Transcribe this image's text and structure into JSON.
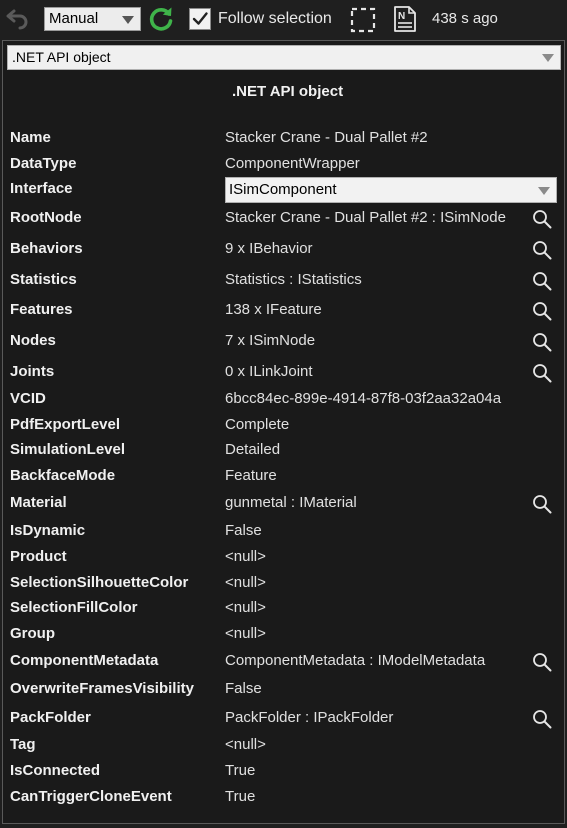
{
  "toolbar": {
    "undo_icon": "undo-icon",
    "mode_value": "Manual",
    "refresh_icon": "refresh-icon",
    "follow_checked": true,
    "follow_label": "Follow selection",
    "select_icon": "selection-frame-icon",
    "doc_icon": "document-icon",
    "doc_icon_glyph": "N",
    "timer_label": "438 s ago",
    "accent_green": "#3fb44a"
  },
  "object_selector": {
    "value": ".NET API object"
  },
  "header": {
    "title": ".NET API object"
  },
  "properties": [
    {
      "name": "Name",
      "value": "Stacker Crane - Dual Pallet #2",
      "search": false
    },
    {
      "name": "DataType",
      "value": "ComponentWrapper",
      "search": false
    },
    {
      "name": "Interface",
      "value": "ISimComponent",
      "search": false,
      "is_dropdown": true
    },
    {
      "name": "RootNode",
      "value": "Stacker Crane - Dual Pallet #2 : ISimNode",
      "search": true
    },
    {
      "name": "Behaviors",
      "value": "9 x IBehavior",
      "search": true
    },
    {
      "name": "Statistics",
      "value": "Statistics : IStatistics",
      "search": true
    },
    {
      "name": "Features",
      "value": "138 x IFeature",
      "search": true
    },
    {
      "name": "Nodes",
      "value": "7 x ISimNode",
      "search": true
    },
    {
      "name": "Joints",
      "value": "0 x ILinkJoint",
      "search": true
    },
    {
      "name": "VCID",
      "value": "6bcc84ec-899e-4914-87f8-03f2aa32a04a",
      "search": false
    },
    {
      "name": "PdfExportLevel",
      "value": "Complete",
      "search": false
    },
    {
      "name": "SimulationLevel",
      "value": "Detailed",
      "search": false
    },
    {
      "name": "BackfaceMode",
      "value": "Feature",
      "search": false
    },
    {
      "name": "Material",
      "value": "gunmetal : IMaterial",
      "search": true
    },
    {
      "name": "IsDynamic",
      "value": "False",
      "search": false
    },
    {
      "name": "Product",
      "value": "<null>",
      "search": false
    },
    {
      "name": "SelectionSilhouetteColor",
      "value": "<null>",
      "search": false
    },
    {
      "name": "SelectionFillColor",
      "value": "<null>",
      "search": false
    },
    {
      "name": "Group",
      "value": "<null>",
      "search": false
    },
    {
      "name": "ComponentMetadata",
      "value": "ComponentMetadata : IModelMetadata",
      "search": true
    },
    {
      "name": "OverwriteFramesVisibility",
      "value": "False",
      "search": false
    },
    {
      "name": "PackFolder",
      "value": "PackFolder : IPackFolder",
      "search": true
    },
    {
      "name": "Tag",
      "value": "<null>",
      "search": false
    },
    {
      "name": "IsConnected",
      "value": "True",
      "search": false
    },
    {
      "name": "CanTriggerCloneEvent",
      "value": "True",
      "search": false
    }
  ]
}
